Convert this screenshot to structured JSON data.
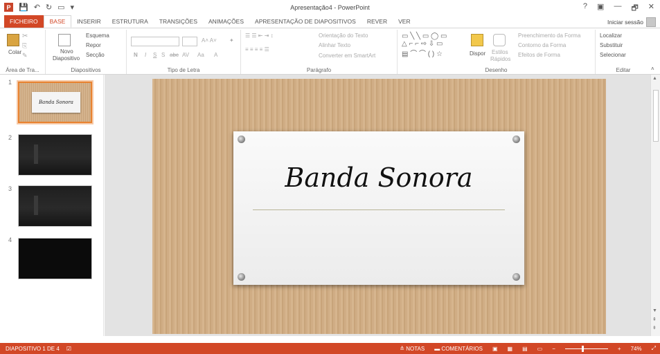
{
  "window": {
    "title": "Apresentação4 - PowerPoint",
    "help": "?",
    "controls": [
      "—",
      "🗗",
      "✕"
    ]
  },
  "tabs": [
    "FICHEIRO",
    "BASE",
    "INSERIR",
    "ESTRUTURA",
    "TRANSIÇÕES",
    "ANIMAÇÕES",
    "APRESENTAÇÃO DE DIAPOSITIVOS",
    "REVER",
    "VER"
  ],
  "active_tab": "BASE",
  "signin": "Iniciar sessão",
  "ribbon": {
    "clipboard": {
      "paste": "Colar",
      "label": "Área de Tra..."
    },
    "slides": {
      "new_slide_1": "Novo",
      "new_slide_2": "Diapositivo",
      "layout": "Esquema",
      "reset": "Repor",
      "section": "Secção",
      "label": "Diapositivos"
    },
    "font": {
      "bold": "N",
      "italic": "I",
      "underline": "S",
      "shadow": "S",
      "strike": "abc",
      "spacing": "AV",
      "case": "Aa",
      "color": "A",
      "label": "Tipo de Letra"
    },
    "paragraph": {
      "direction": "Orientação do Texto",
      "align_text": "Alinhar Texto",
      "smartart": "Converter em SmartArt",
      "label": "Parágrafo"
    },
    "drawing": {
      "arrange": "Dispor",
      "styles_1": "Estilos",
      "styles_2": "Rápidos",
      "fill": "Preenchimento da Forma",
      "outline": "Contorno da Forma",
      "effects": "Efeitos de Forma",
      "label": "Desenho"
    },
    "editing": {
      "find": "Localizar",
      "replace": "Substituir",
      "select": "Selecionar",
      "label": "Editar"
    }
  },
  "thumbnails": [
    {
      "num": "1",
      "title": "Banda Sonora"
    },
    {
      "num": "2"
    },
    {
      "num": "3"
    },
    {
      "num": "4"
    }
  ],
  "slide": {
    "title": "Banda Sonora"
  },
  "status": {
    "slide_of": "DIAPOSITIVO 1 DE 4",
    "notes": "NOTAS",
    "comments": "COMENTÁRIOS",
    "zoom": "74%",
    "zoom_fraction": 0.74
  },
  "colors": {
    "accent": "#d24726",
    "selection": "#e8822f"
  }
}
